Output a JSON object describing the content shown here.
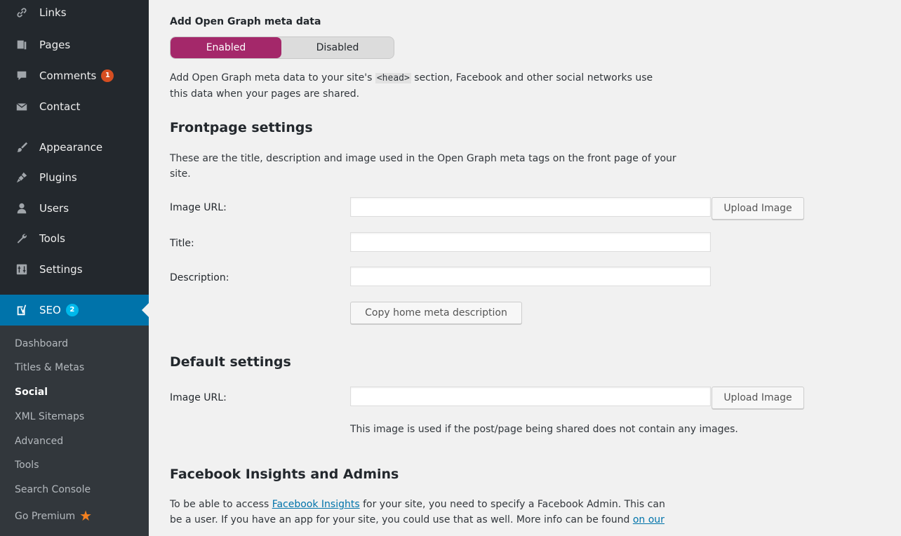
{
  "sidebar": {
    "items": [
      {
        "label": "Links",
        "icon": "link-icon"
      },
      {
        "label": "Pages",
        "icon": "pages-icon"
      },
      {
        "label": "Comments",
        "icon": "comments-icon",
        "count": "1"
      },
      {
        "label": "Contact",
        "icon": "envelope-icon"
      },
      {
        "label": "Appearance",
        "icon": "paintbrush-icon"
      },
      {
        "label": "Plugins",
        "icon": "plugin-icon"
      },
      {
        "label": "Users",
        "icon": "users-icon"
      },
      {
        "label": "Tools",
        "icon": "wrench-icon"
      },
      {
        "label": "Settings",
        "icon": "settings-icon"
      }
    ],
    "seo": {
      "label": "SEO",
      "count": "2",
      "icon": "yoast-icon"
    },
    "submenu": [
      {
        "label": "Dashboard"
      },
      {
        "label": "Titles & Metas"
      },
      {
        "label": "Social",
        "current": true
      },
      {
        "label": "XML Sitemaps"
      },
      {
        "label": "Advanced"
      },
      {
        "label": "Tools"
      },
      {
        "label": "Search Console"
      },
      {
        "label": "Go Premium",
        "icon": "star-icon"
      }
    ]
  },
  "opengraph": {
    "label": "Add Open Graph meta data",
    "enabled_label": "Enabled",
    "disabled_label": "Disabled",
    "selected": "Enabled",
    "desc_pre": "Add Open Graph meta data to your site's ",
    "desc_code": "<head>",
    "desc_post": " section, Facebook and other social networks use",
    "desc_line2": "this data when your pages are shared."
  },
  "frontpage": {
    "heading": "Frontpage settings",
    "desc_line1": "These are the title, description and image used in the Open Graph meta tags on the front page of your",
    "desc_line2": "site.",
    "image_url_label": "Image URL:",
    "image_url_value": "",
    "upload_button": "Upload Image",
    "title_label": "Title:",
    "title_value": "",
    "description_label": "Description:",
    "description_value": "",
    "copy_button": "Copy home meta description"
  },
  "defaults": {
    "heading": "Default settings",
    "image_url_label": "Image URL:",
    "image_url_value": "",
    "upload_button": "Upload Image",
    "help": "This image is used if the post/page being shared does not contain any images."
  },
  "facebook": {
    "heading": "Facebook Insights and Admins",
    "line1_pre": "To be able to access ",
    "line1_link": "Facebook Insights",
    "line1_post": " for your site, you need to specify a Facebook Admin. This can",
    "line2_pre": "be a user. If you have an app for your site, you could use that as well. More info can be found ",
    "line2_link": "on our"
  },
  "colors": {
    "sidebar_bg": "#23282d",
    "seo_active": "#0073aa",
    "toggle_enabled": "#a4286a",
    "badge": "#d54e21"
  }
}
